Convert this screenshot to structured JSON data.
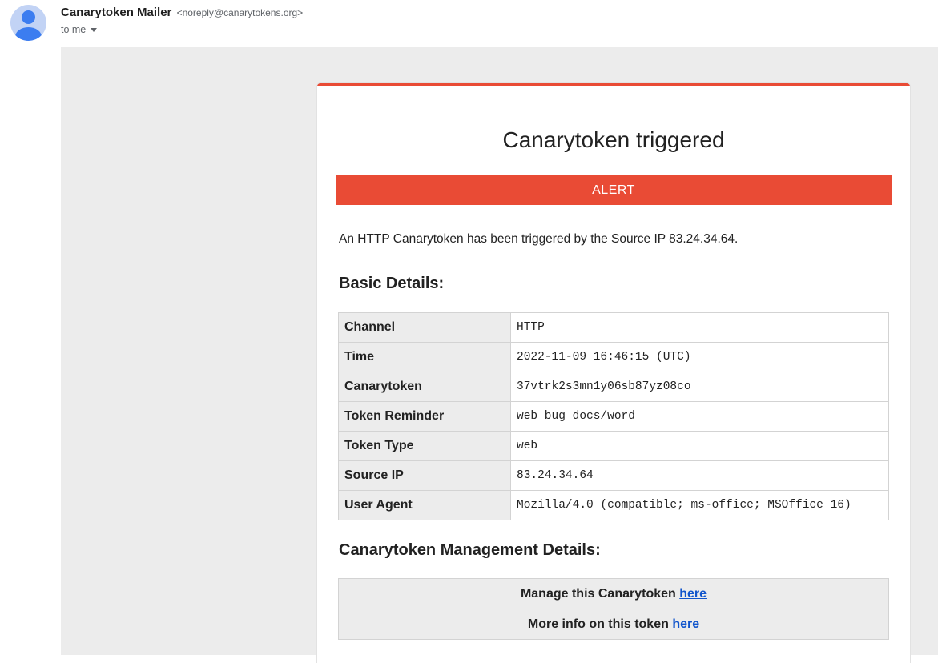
{
  "email": {
    "sender_name": "Canarytoken Mailer",
    "sender_email": "<noreply@canarytokens.org>",
    "to_label": "to me"
  },
  "card": {
    "title": "Canarytoken triggered",
    "alert_label": "ALERT",
    "message": "An HTTP Canarytoken has been triggered by the Source IP 83.24.34.64.",
    "basic_heading": "Basic Details:",
    "details": [
      {
        "key": "Channel",
        "value": "HTTP"
      },
      {
        "key": "Time",
        "value": "2022-11-09 16:46:15 (UTC)"
      },
      {
        "key": "Canarytoken",
        "value": "37vtrk2s3mn1y06sb87yz08co"
      },
      {
        "key": "Token Reminder",
        "value": "web bug docs/word"
      },
      {
        "key": "Token Type",
        "value": "web"
      },
      {
        "key": "Source IP",
        "value": "83.24.34.64"
      },
      {
        "key": "User Agent",
        "value": "Mozilla/4.0 (compatible; ms-office; MSOffice 16)"
      }
    ],
    "mgmt_heading": "Canarytoken Management Details:",
    "manage_text": "Manage this Canarytoken ",
    "manage_link": "here",
    "info_text": "More info on this token ",
    "info_link": "here"
  },
  "colors": {
    "accent": "#e94b35",
    "link": "#1155cc",
    "avatar_bg": "#c2d3f5",
    "avatar_fg": "#3c7df0"
  },
  "icons": {
    "avatar": "avatar-icon",
    "recipient_dropdown": "caret-down-icon"
  }
}
